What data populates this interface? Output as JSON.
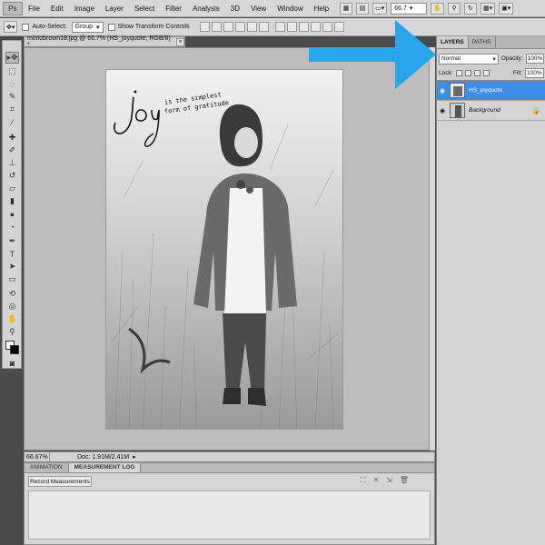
{
  "menubar": {
    "logo": "Ps",
    "items": [
      "File",
      "Edit",
      "Image",
      "Layer",
      "Select",
      "Filter",
      "Analysis",
      "3D",
      "View",
      "Window",
      "Help"
    ],
    "zoom": "66.7"
  },
  "options": {
    "auto_select_label": "Auto-Select:",
    "auto_select_value": "Group",
    "show_transform_label": "Show Transform Controls"
  },
  "document": {
    "tab_title": "mintobrown18.jpg @ 66.7% (HS_joyquote, RGB/8) *",
    "close": "×",
    "quote_word": "joy",
    "quote_line1": "is the simplest",
    "quote_line2": "form of gratitude"
  },
  "status": {
    "zoom": "66.67%",
    "doc": "Doc: 1.91M/2.41M"
  },
  "bottom_panel": {
    "tabs": [
      "ANIMATION",
      "MEASUREMENT LOG"
    ],
    "record_button": "Record Measurements"
  },
  "layers": {
    "tabs": [
      "LAYERS",
      "PATHS"
    ],
    "blend_mode": "Normal",
    "opacity_label": "Opacity:",
    "opacity": "100%",
    "lock_label": "Lock:",
    "fill_label": "Fill:",
    "fill": "100%",
    "items": [
      {
        "name": "HS_joyquote",
        "selected": true
      },
      {
        "name": "Background",
        "selected": false
      }
    ]
  },
  "colors": {
    "selection": "#3c8ee8",
    "arrow": "#27a6ec"
  }
}
